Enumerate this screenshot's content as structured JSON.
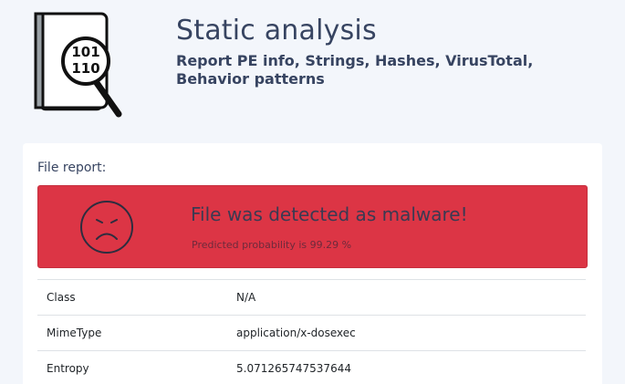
{
  "header": {
    "title": "Static analysis",
    "subtitle": "Report PE info, Strings, Hashes, VirusTotal, Behavior patterns",
    "logo_icon": "binary-magnifier-icon",
    "logo_digits_top": "101",
    "logo_digits_bottom": "110"
  },
  "report": {
    "label": "File report:",
    "alert": {
      "icon": "sad-face-icon",
      "title": "File was detected as malware!",
      "detail": "Predicted probability is 99.29 %",
      "color": "#dc3545"
    },
    "rows": [
      {
        "key": "Class",
        "value": "N/A"
      },
      {
        "key": "MimeType",
        "value": "application/x-dosexec"
      },
      {
        "key": "Entropy",
        "value": "5.071265747537644"
      }
    ]
  }
}
